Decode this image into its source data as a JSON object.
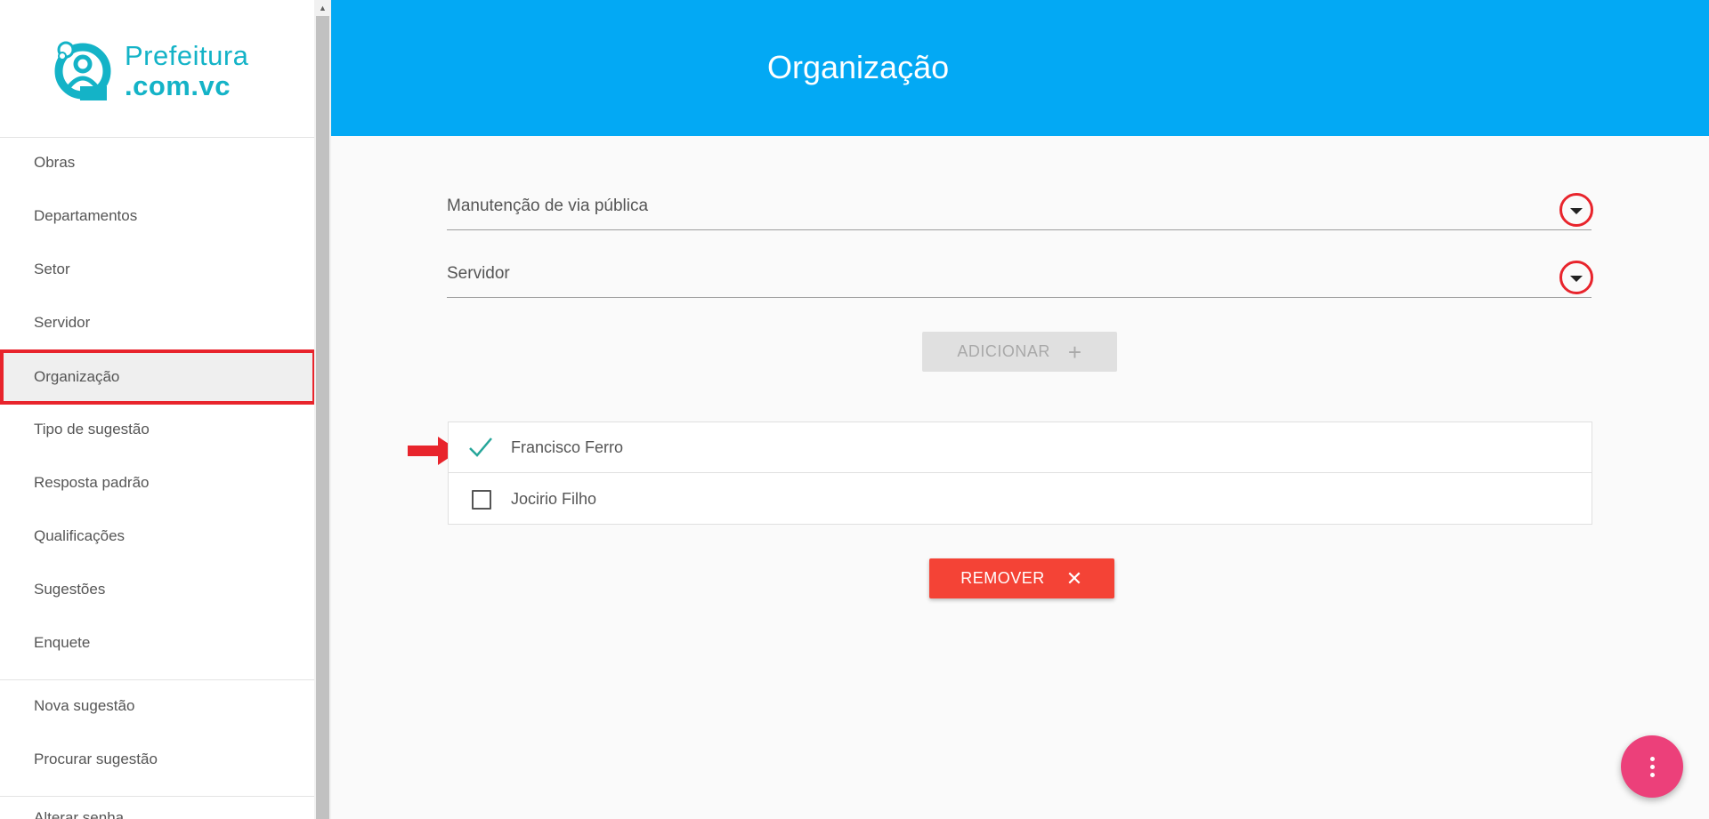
{
  "brand": {
    "line1": "Prefeitura",
    "line2": ".com.vc",
    "color": "#14b3c7"
  },
  "sidebar": {
    "items": [
      {
        "label": "Obras"
      },
      {
        "label": "Departamentos"
      },
      {
        "label": "Setor"
      },
      {
        "label": "Servidor"
      },
      {
        "label": "Organização",
        "active": true
      },
      {
        "label": "Tipo de sugestão"
      },
      {
        "label": "Resposta padrão"
      },
      {
        "label": "Qualificações"
      },
      {
        "label": "Sugestões"
      },
      {
        "label": "Enquete"
      },
      {
        "label": "Nova sugestão"
      },
      {
        "label": "Procurar sugestão"
      },
      {
        "label": "Alterar senha"
      }
    ]
  },
  "header": {
    "title": "Organização",
    "color": "#03a9f4"
  },
  "form": {
    "department_select": {
      "value": "Manutenção de via pública",
      "icon": "dropdown-arrow-icon"
    },
    "servidor_select": {
      "value": "Servidor",
      "icon": "dropdown-arrow-icon"
    },
    "add_button": {
      "label": "ADICIONAR",
      "icon_char": "+",
      "enabled": false
    }
  },
  "list": {
    "items": [
      {
        "name": "Francisco Ferro",
        "checked": true
      },
      {
        "name": "Jocirio Filho",
        "checked": false
      }
    ]
  },
  "remove_button": {
    "label": "REMOVER",
    "icon_char": "✕",
    "color": "#f44336"
  },
  "fab": {
    "icon": "more-vert-icon",
    "color": "#ec407a"
  },
  "annotations": {
    "highlight_color": "#e8242c"
  }
}
